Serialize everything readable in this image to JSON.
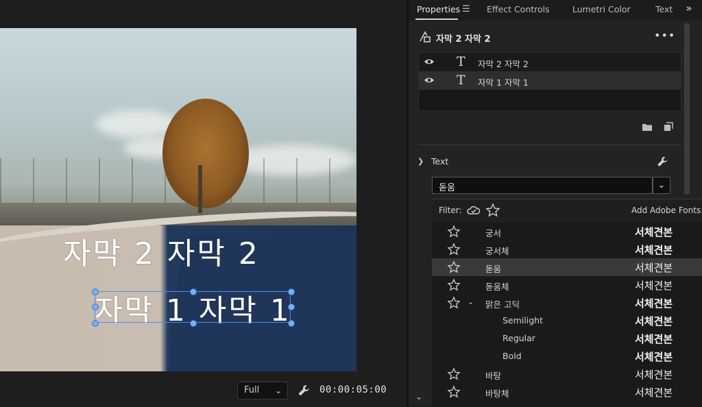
{
  "monitor": {
    "captions": [
      "자막 2 자막 2",
      "자막 1 자막 1"
    ],
    "zoom": "Full",
    "timecode": "00:00:05:00"
  },
  "tabs": [
    {
      "label": "Properties",
      "active": true
    },
    {
      "label": "Effect Controls"
    },
    {
      "label": "Lumetri Color"
    },
    {
      "label": "Text"
    }
  ],
  "properties": {
    "object_title": "자막 2 자막 2",
    "layers": [
      {
        "name": "자막 2 자막 2",
        "icon": "text-layer-icon"
      },
      {
        "name": "자막 1 자막 1",
        "icon": "text-layer-icon",
        "selected": true
      }
    ],
    "text_section": {
      "title": "Text",
      "font": "돋움"
    }
  },
  "font_dropdown": {
    "filter_label": "Filter:",
    "add_fonts_label": "Add Adobe Fonts:",
    "fonts": [
      {
        "name": "궁서",
        "sample": "서체견본",
        "style": "serif"
      },
      {
        "name": "궁서체",
        "sample": "서체견본",
        "style": "serif"
      },
      {
        "name": "돋움",
        "sample": "서체견본",
        "highlighted": true
      },
      {
        "name": "돋움체",
        "sample": "서체견본"
      },
      {
        "name": "맑은 고딕",
        "sample": "서체견본",
        "expandable": true,
        "style": "bold"
      },
      {
        "name": "Semilight",
        "sample": "서체견본",
        "sub": true,
        "style": "bold"
      },
      {
        "name": "Regular",
        "sample": "서체견본",
        "sub": true,
        "style": "bold"
      },
      {
        "name": "Bold",
        "sample": "서체견본",
        "sub": true,
        "style": "bold"
      },
      {
        "name": "바탕",
        "sample": "서체견본"
      },
      {
        "name": "바탕체",
        "sample": "서체견본"
      }
    ]
  },
  "colors": {
    "accent": "#4d8fe6",
    "panel_bg": "#232323",
    "highlight_row": "#3a3a3a"
  }
}
